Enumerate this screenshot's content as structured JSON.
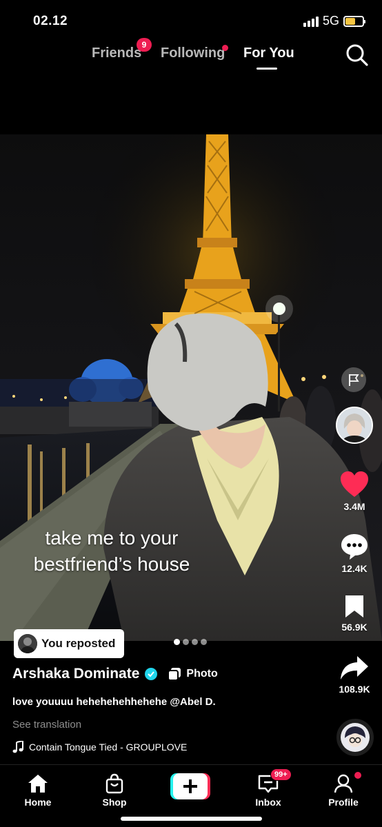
{
  "status": {
    "time": "02.12",
    "network": "5G"
  },
  "top_nav": {
    "tabs": [
      {
        "label": "Friends",
        "badge": "9"
      },
      {
        "label": "Following"
      },
      {
        "label": "For You",
        "active": true
      }
    ]
  },
  "post": {
    "overlay_text_line1": "take me to your",
    "overlay_text_line2": "bestfriend’s house",
    "repost_label": "You reposted",
    "author": "Arshaka Dominate",
    "media_type": "Photo",
    "caption": "love youuuu hehehehehhehehe @Abel D.",
    "see_translation": "See translation",
    "music": "Contain Tongue Tied - GROUPLOVE",
    "photo_count": 4,
    "current_photo": 1
  },
  "actions": {
    "likes": "3.4M",
    "comments": "12.4K",
    "saves": "56.9K",
    "shares": "108.9K"
  },
  "bottom_nav": {
    "home": "Home",
    "shop": "Shop",
    "inbox": "Inbox",
    "inbox_badge": "99+",
    "profile": "Profile"
  },
  "colors": {
    "like": "#fe2c55",
    "badge": "#ee1d52",
    "verified": "#20d5ec",
    "tower_gold": "#e8a21c"
  }
}
